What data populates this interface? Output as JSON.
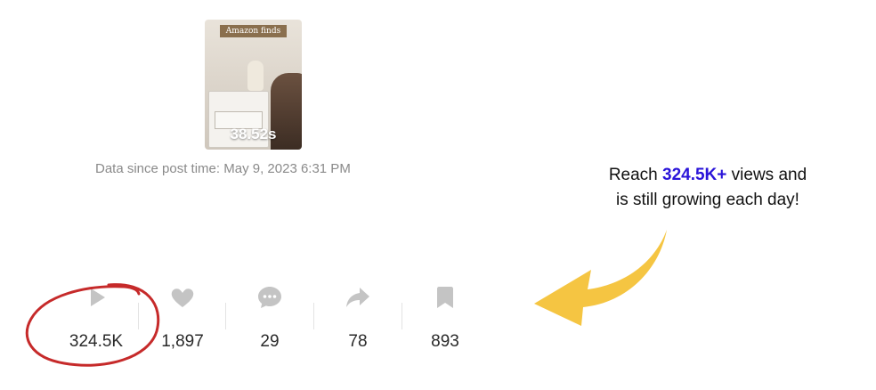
{
  "thumbnail": {
    "tag": "Amazon finds",
    "duration": "38.52s"
  },
  "post_since": "Data since post time: May 9, 2023 6:31 PM",
  "callout": {
    "prefix": "Reach ",
    "highlight": "324.5K+",
    "suffix": " views and",
    "line2": "is still growing each day!",
    "highlight_color": "#2a14d9",
    "arrow_color": "#f5c542"
  },
  "stats": {
    "views": "324.5K",
    "likes": "1,897",
    "comments": "29",
    "shares": "78",
    "saves": "893"
  },
  "colors": {
    "icon": "#c4c4c4",
    "circle": "#c62a2a"
  }
}
